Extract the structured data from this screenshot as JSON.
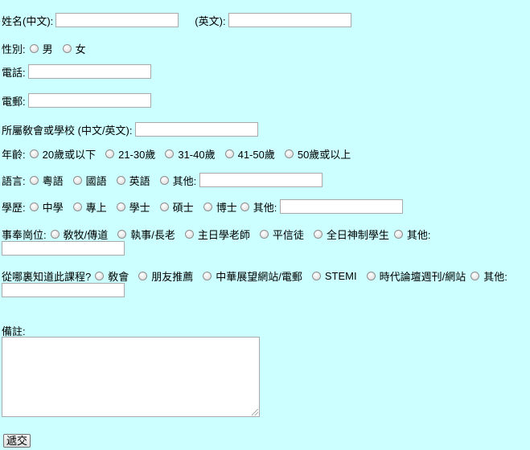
{
  "name": {
    "label_zh": "姓名(中文):",
    "label_en": "(英文):",
    "value_zh": "",
    "value_en": ""
  },
  "gender": {
    "label": "性別:",
    "options": [
      "男",
      "女"
    ]
  },
  "phone": {
    "label": "電話:",
    "value": ""
  },
  "email": {
    "label": "電郵:",
    "value": ""
  },
  "church": {
    "label": "所屬敎會或學校 (中文/英文):",
    "value": ""
  },
  "age": {
    "label": "年齡:",
    "options": [
      "20歲或以下",
      "21-30歲",
      "31-40歲",
      "41-50歲",
      "50歲或以上"
    ]
  },
  "language": {
    "label": "語言:",
    "options": [
      "粵語",
      "國語",
      "英語"
    ],
    "other_label": "其他:",
    "other_value": ""
  },
  "education": {
    "label": "學歷:",
    "options": [
      "中學",
      "專上",
      "學士",
      "碩士",
      "博士"
    ],
    "other_label": "其他:",
    "other_value": ""
  },
  "ministry": {
    "label": "事奉崗位:",
    "options": [
      "敎牧/傳道",
      "執事/長老",
      "主日學老師",
      "平信徒",
      "全日神制學生"
    ],
    "other_label": "其他:",
    "other_value": ""
  },
  "source": {
    "label": "從哪裏知道此課程?",
    "options": [
      "敎會",
      "朋友推薦",
      "中華展望網站/電郵",
      "STEMI",
      "時代論壇週刊/網站"
    ],
    "other_label": "其他:",
    "other_value": ""
  },
  "remarks": {
    "label": "備註:",
    "value": ""
  },
  "submit_label": "遞交"
}
